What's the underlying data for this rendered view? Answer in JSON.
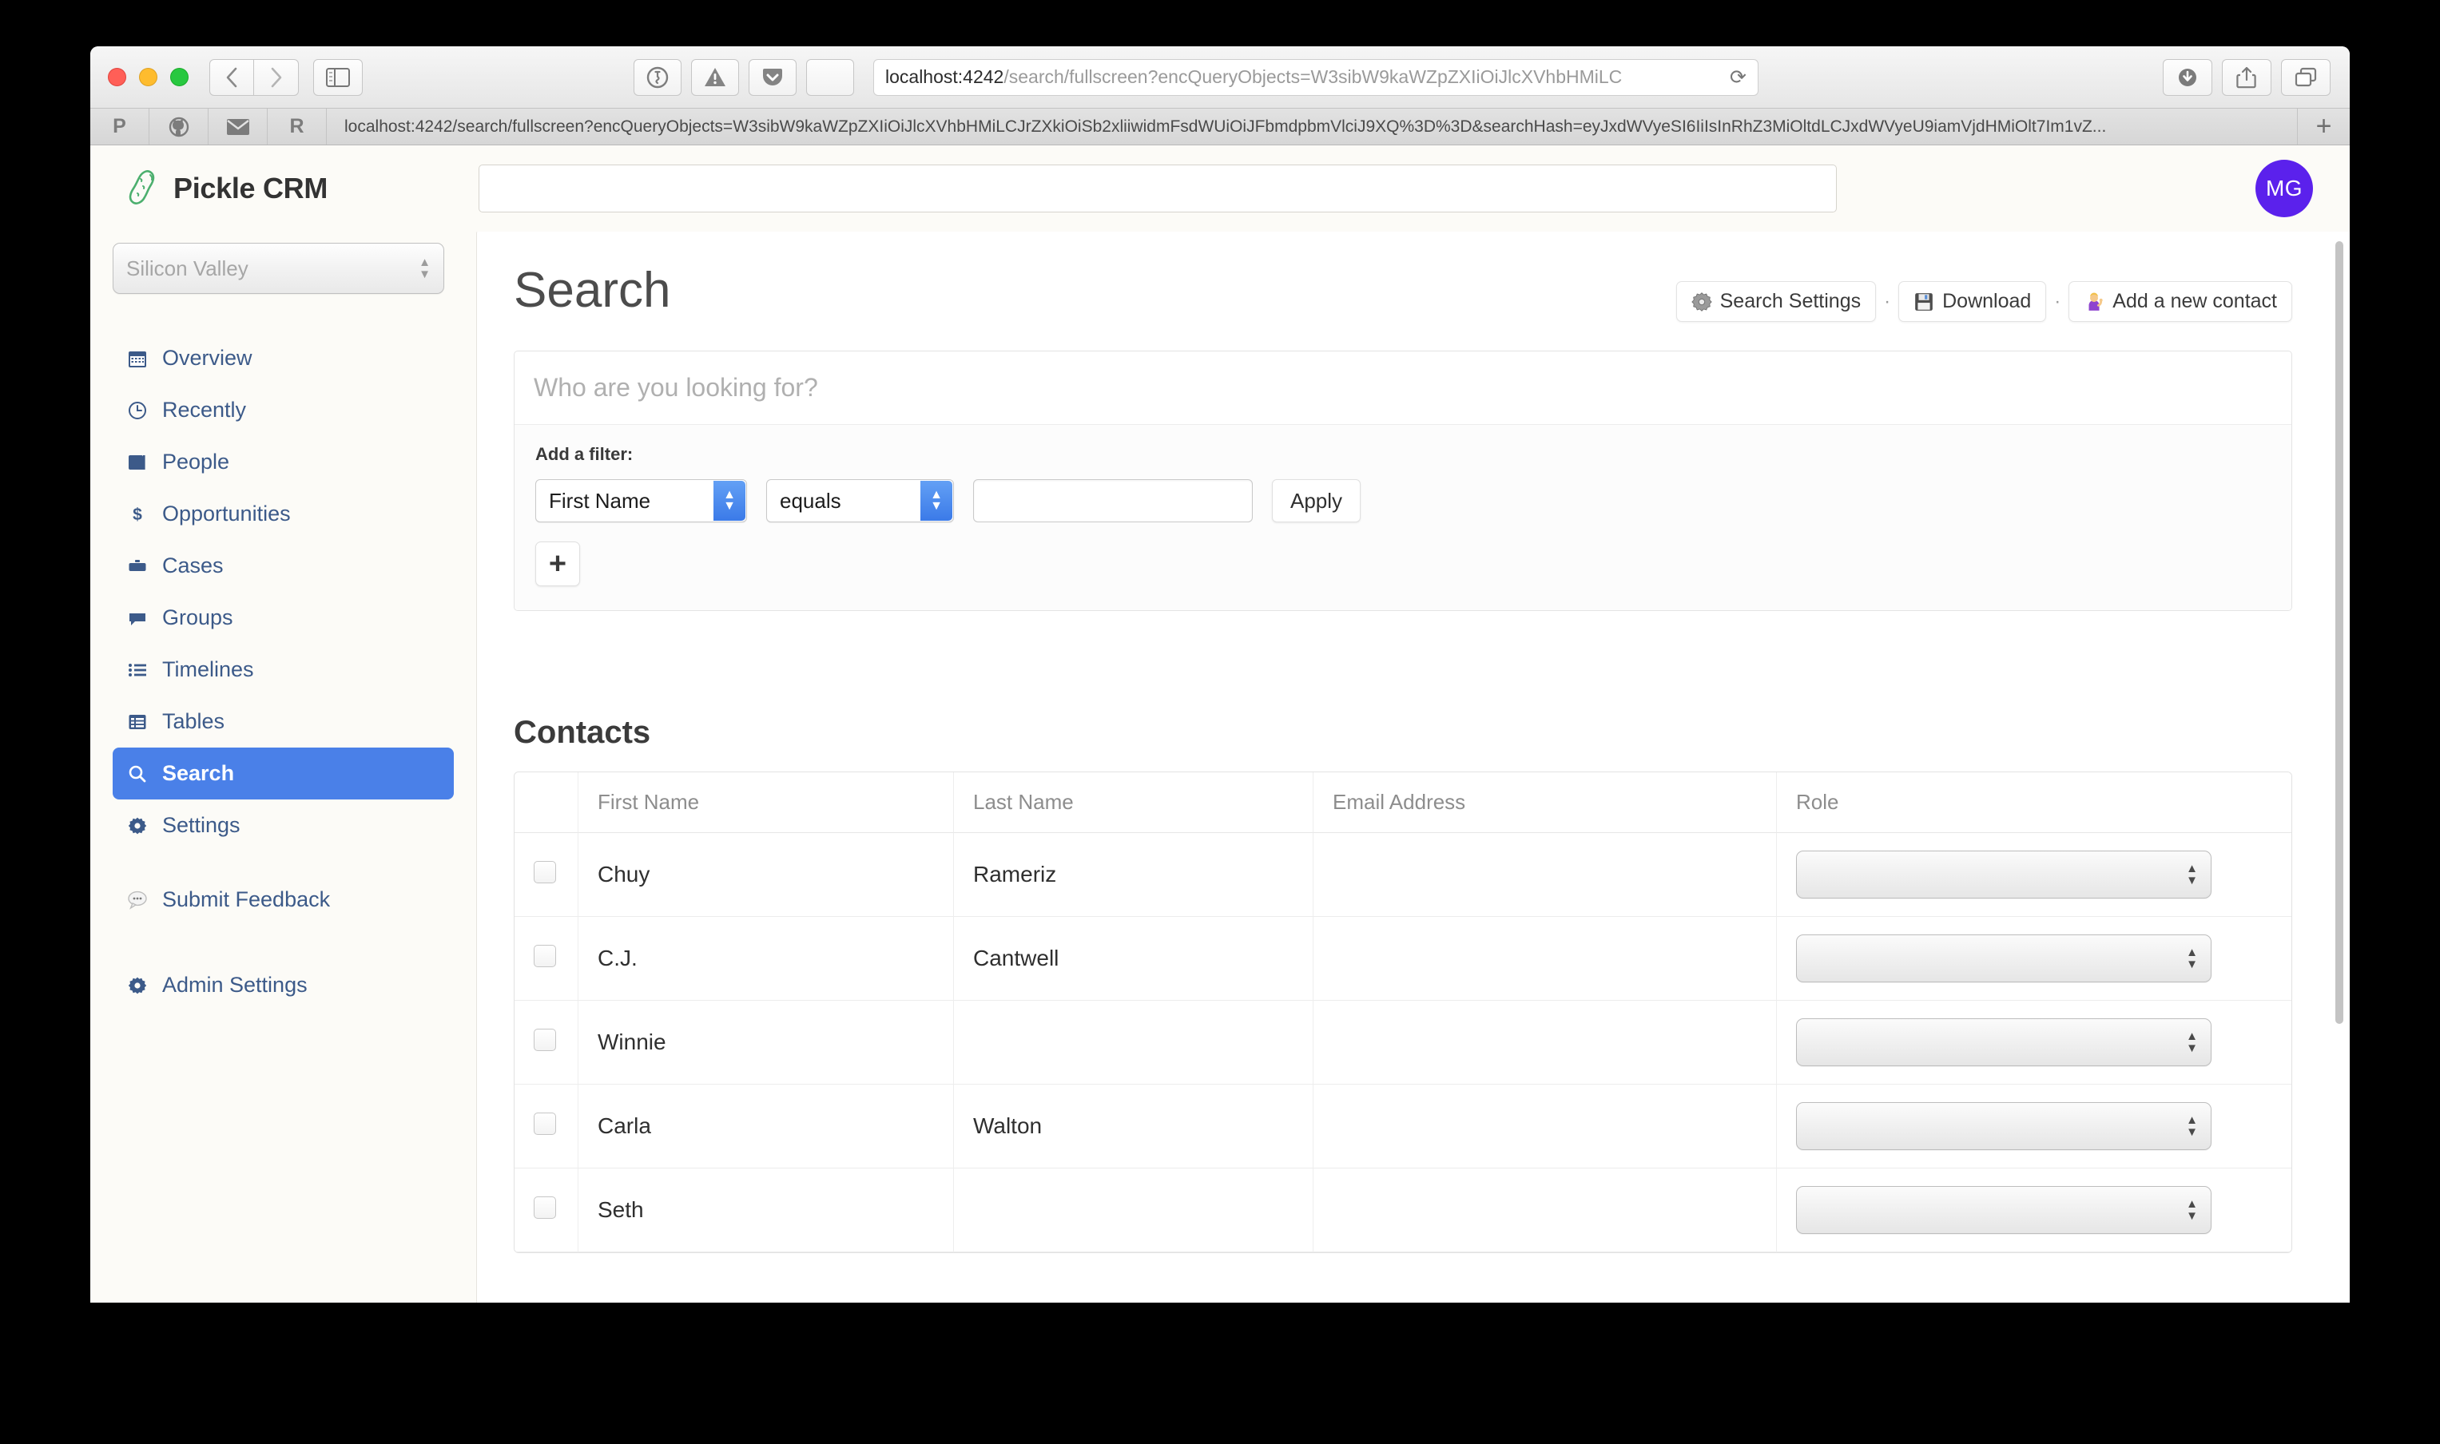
{
  "browser": {
    "url_host": "localhost:4242",
    "url_path": "/search/fullscreen?encQueryObjects=W3sibW9kaWZpZXIiOiJlcXVhbHMiLC",
    "bookmark_url": "localhost:4242/search/fullscreen?encQueryObjects=W3sibW9kaWZpZXIiOiJlcXVhbHMiLCJrZXkiOiSb2xliiwidmFsdWUiOiJFbmdpbmVlciJ9XQ%3D%3D&searchHash=eyJxdWVyeSI6IiIsInRhZ3MiOltdLCJxdWVyeU9iamVjdHMiOlt7Im1vZ...",
    "bookmarks": [
      {
        "name": "pocket-bookmark",
        "label": "P"
      },
      {
        "name": "github-bookmark",
        "label": "●"
      },
      {
        "name": "mail-bookmark",
        "label": "✉"
      },
      {
        "name": "reddit-bookmark",
        "label": "R"
      }
    ],
    "new_tab_label": "+",
    "reload_label": "⟳",
    "toolbar_icons": [
      "back-icon",
      "forward-icon",
      "sidebar-icon",
      "onepassword-icon",
      "warning-icon",
      "pocket-icon",
      "shield-icon",
      "downloads-icon",
      "share-icon",
      "tabs-icon"
    ]
  },
  "app": {
    "brand": "Pickle CRM",
    "global_search_value": "",
    "global_search_placeholder": "",
    "avatar_initials": "MG"
  },
  "sidebar": {
    "org_selected": "Silicon Valley",
    "items": [
      {
        "label": "Overview",
        "icon": "calendar-icon",
        "active": false
      },
      {
        "label": "Recently",
        "icon": "clock-icon",
        "active": false
      },
      {
        "label": "People",
        "icon": "book-icon",
        "active": false
      },
      {
        "label": "Opportunities",
        "icon": "dollar-icon",
        "active": false
      },
      {
        "label": "Cases",
        "icon": "briefcase-icon",
        "active": false
      },
      {
        "label": "Groups",
        "icon": "chat-icon",
        "active": false
      },
      {
        "label": "Timelines",
        "icon": "list-icon",
        "active": false
      },
      {
        "label": "Tables",
        "icon": "table-icon",
        "active": false
      },
      {
        "label": "Search",
        "icon": "search-icon",
        "active": true
      },
      {
        "label": "Settings",
        "icon": "gear-icon",
        "active": false
      }
    ],
    "feedback": {
      "label": "Submit Feedback",
      "icon": "speech-bubble-icon"
    },
    "admin": {
      "label": "Admin Settings",
      "icon": "gear-icon"
    }
  },
  "main": {
    "page_title": "Search",
    "actions": [
      {
        "label": "Search Settings",
        "icon": "gear-icon"
      },
      {
        "label": "Download",
        "icon": "floppy-disk-icon"
      },
      {
        "label": "Add a new contact",
        "icon": "person-raising-hand-icon"
      }
    ],
    "action_separator": "·",
    "search": {
      "value": "",
      "placeholder": "Who are you looking for?",
      "filter_label": "Add a filter:",
      "filter_field": "First Name",
      "filter_operator": "equals",
      "filter_value": "",
      "filter_value_placeholder": "",
      "apply_label": "Apply",
      "add_filter_label": "+"
    },
    "contacts": {
      "title": "Contacts",
      "columns": [
        "",
        "First Name",
        "Last Name",
        "Email Address",
        "Role"
      ],
      "rows": [
        {
          "first": "Chuy",
          "last": "Rameriz",
          "email": "",
          "role": ""
        },
        {
          "first": "C.J.",
          "last": "Cantwell",
          "email": "",
          "role": ""
        },
        {
          "first": "Winnie",
          "last": "",
          "email": "",
          "role": ""
        },
        {
          "first": "Carla",
          "last": "Walton",
          "email": "",
          "role": ""
        },
        {
          "first": "Seth",
          "last": "",
          "email": "",
          "role": ""
        }
      ]
    }
  },
  "colors": {
    "accent_blue": "#4a80e8",
    "nav_text": "#3c5a89",
    "avatar_purple": "#5b21ec",
    "pickle_green": "#4caf6e",
    "app_bg": "#fcfbf7"
  }
}
